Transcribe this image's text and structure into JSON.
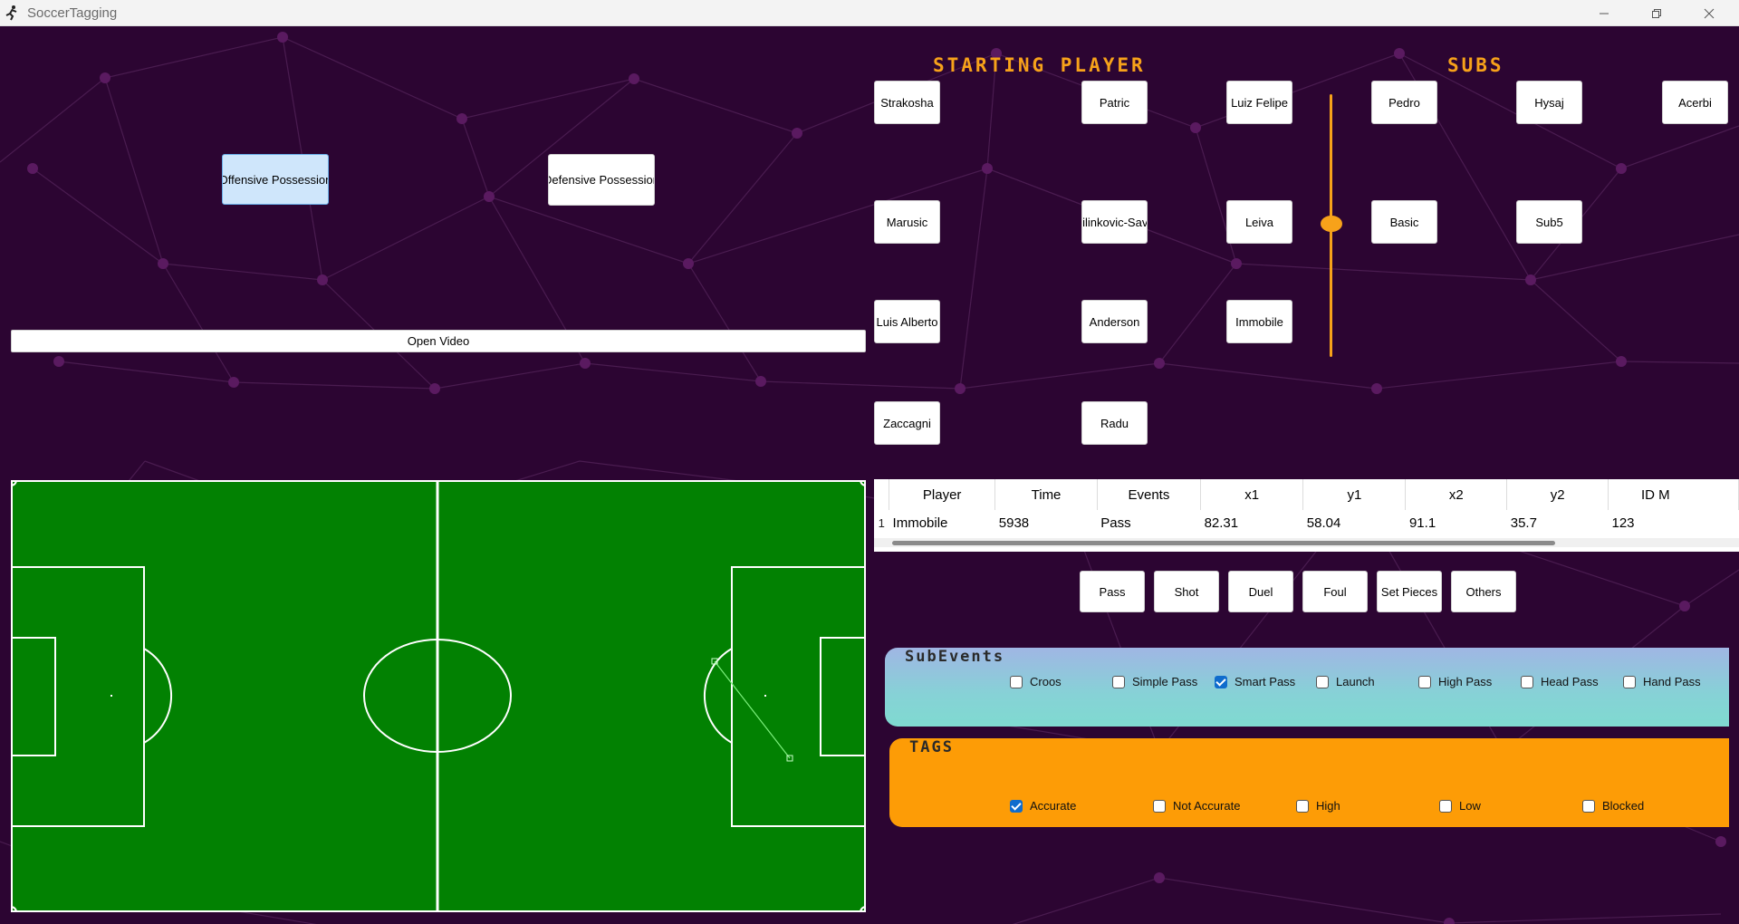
{
  "window": {
    "title": "SoccerTagging"
  },
  "possession": {
    "offensive_label": "Offensive Possession",
    "defensive_label": "Defensive Possession"
  },
  "open_video_label": "Open Video",
  "starting_heading": "STARTING PLAYER",
  "subs_heading": "SUBS",
  "starters": [
    "Strakosha",
    "Patric",
    "Luiz Felipe",
    "Marusic",
    "Milinkovic-Savic",
    "Leiva",
    "Luis Alberto",
    "Anderson",
    "Immobile",
    "Zaccagni",
    "Radu"
  ],
  "subs": [
    "Pedro",
    "Hysaj",
    "Acerbi",
    "Basic",
    "Sub5"
  ],
  "table": {
    "columns": [
      "Player",
      "Time",
      "Events",
      "x1",
      "y1",
      "x2",
      "y2",
      "ID M"
    ],
    "rows": [
      {
        "num": "1",
        "cells": [
          "Immobile",
          "5938",
          "Pass",
          "82.31",
          "58.04",
          "91.1",
          "35.7",
          "123"
        ]
      }
    ]
  },
  "events": [
    "Pass",
    "Shot",
    "Duel",
    "Foul",
    "Set Pieces",
    "Others"
  ],
  "subevents": {
    "title": "SubEvents",
    "items": [
      {
        "label": "Croos",
        "checked": false
      },
      {
        "label": "Simple Pass",
        "checked": false
      },
      {
        "label": "Smart Pass",
        "checked": true
      },
      {
        "label": "Launch",
        "checked": false
      },
      {
        "label": "High Pass",
        "checked": false
      },
      {
        "label": "Head Pass",
        "checked": false
      },
      {
        "label": "Hand Pass",
        "checked": false
      }
    ]
  },
  "tags": {
    "title": "TAGS",
    "items": [
      {
        "label": "Accurate",
        "checked": true
      },
      {
        "label": "Not Accurate",
        "checked": false
      },
      {
        "label": "High",
        "checked": false
      },
      {
        "label": "Low",
        "checked": false
      },
      {
        "label": "Blocked",
        "checked": false
      }
    ]
  },
  "colors": {
    "accent": "#f7a21a",
    "pitch": "#028102",
    "background": "#2c0532"
  }
}
